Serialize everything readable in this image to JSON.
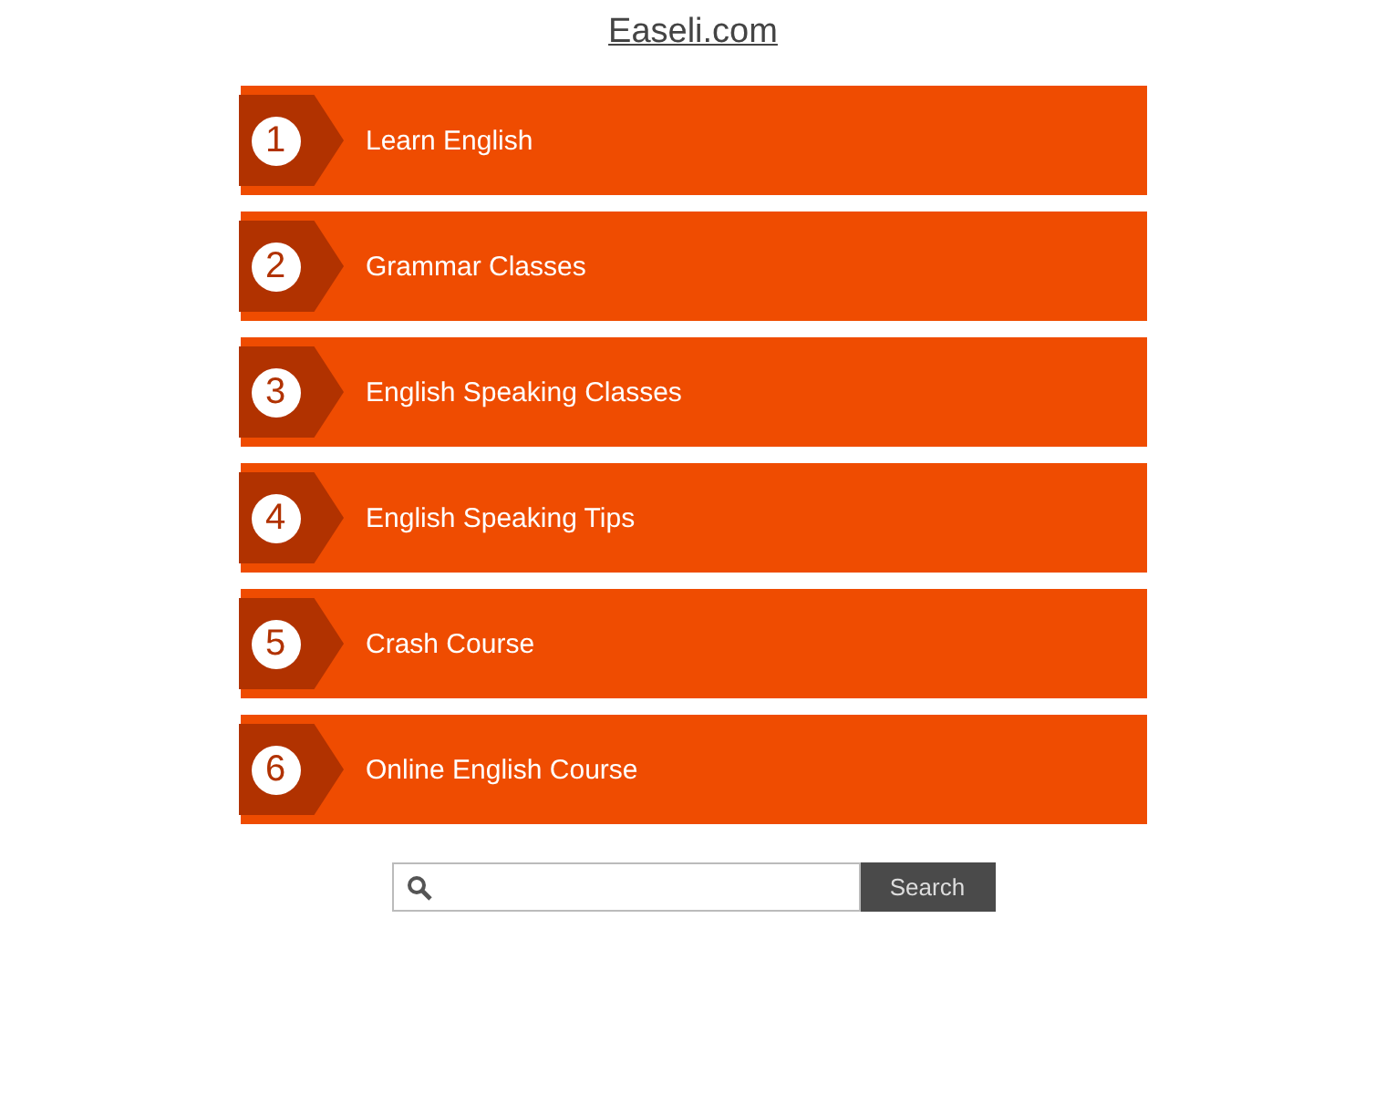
{
  "site_title": "Easeli.com",
  "links": [
    {
      "number": "1",
      "label": "Learn English"
    },
    {
      "number": "2",
      "label": "Grammar Classes"
    },
    {
      "number": "3",
      "label": "English Speaking Classes"
    },
    {
      "number": "4",
      "label": "English Speaking Tips"
    },
    {
      "number": "5",
      "label": "Crash Course"
    },
    {
      "number": "6",
      "label": "Online English Course"
    }
  ],
  "search": {
    "button": "Search"
  }
}
